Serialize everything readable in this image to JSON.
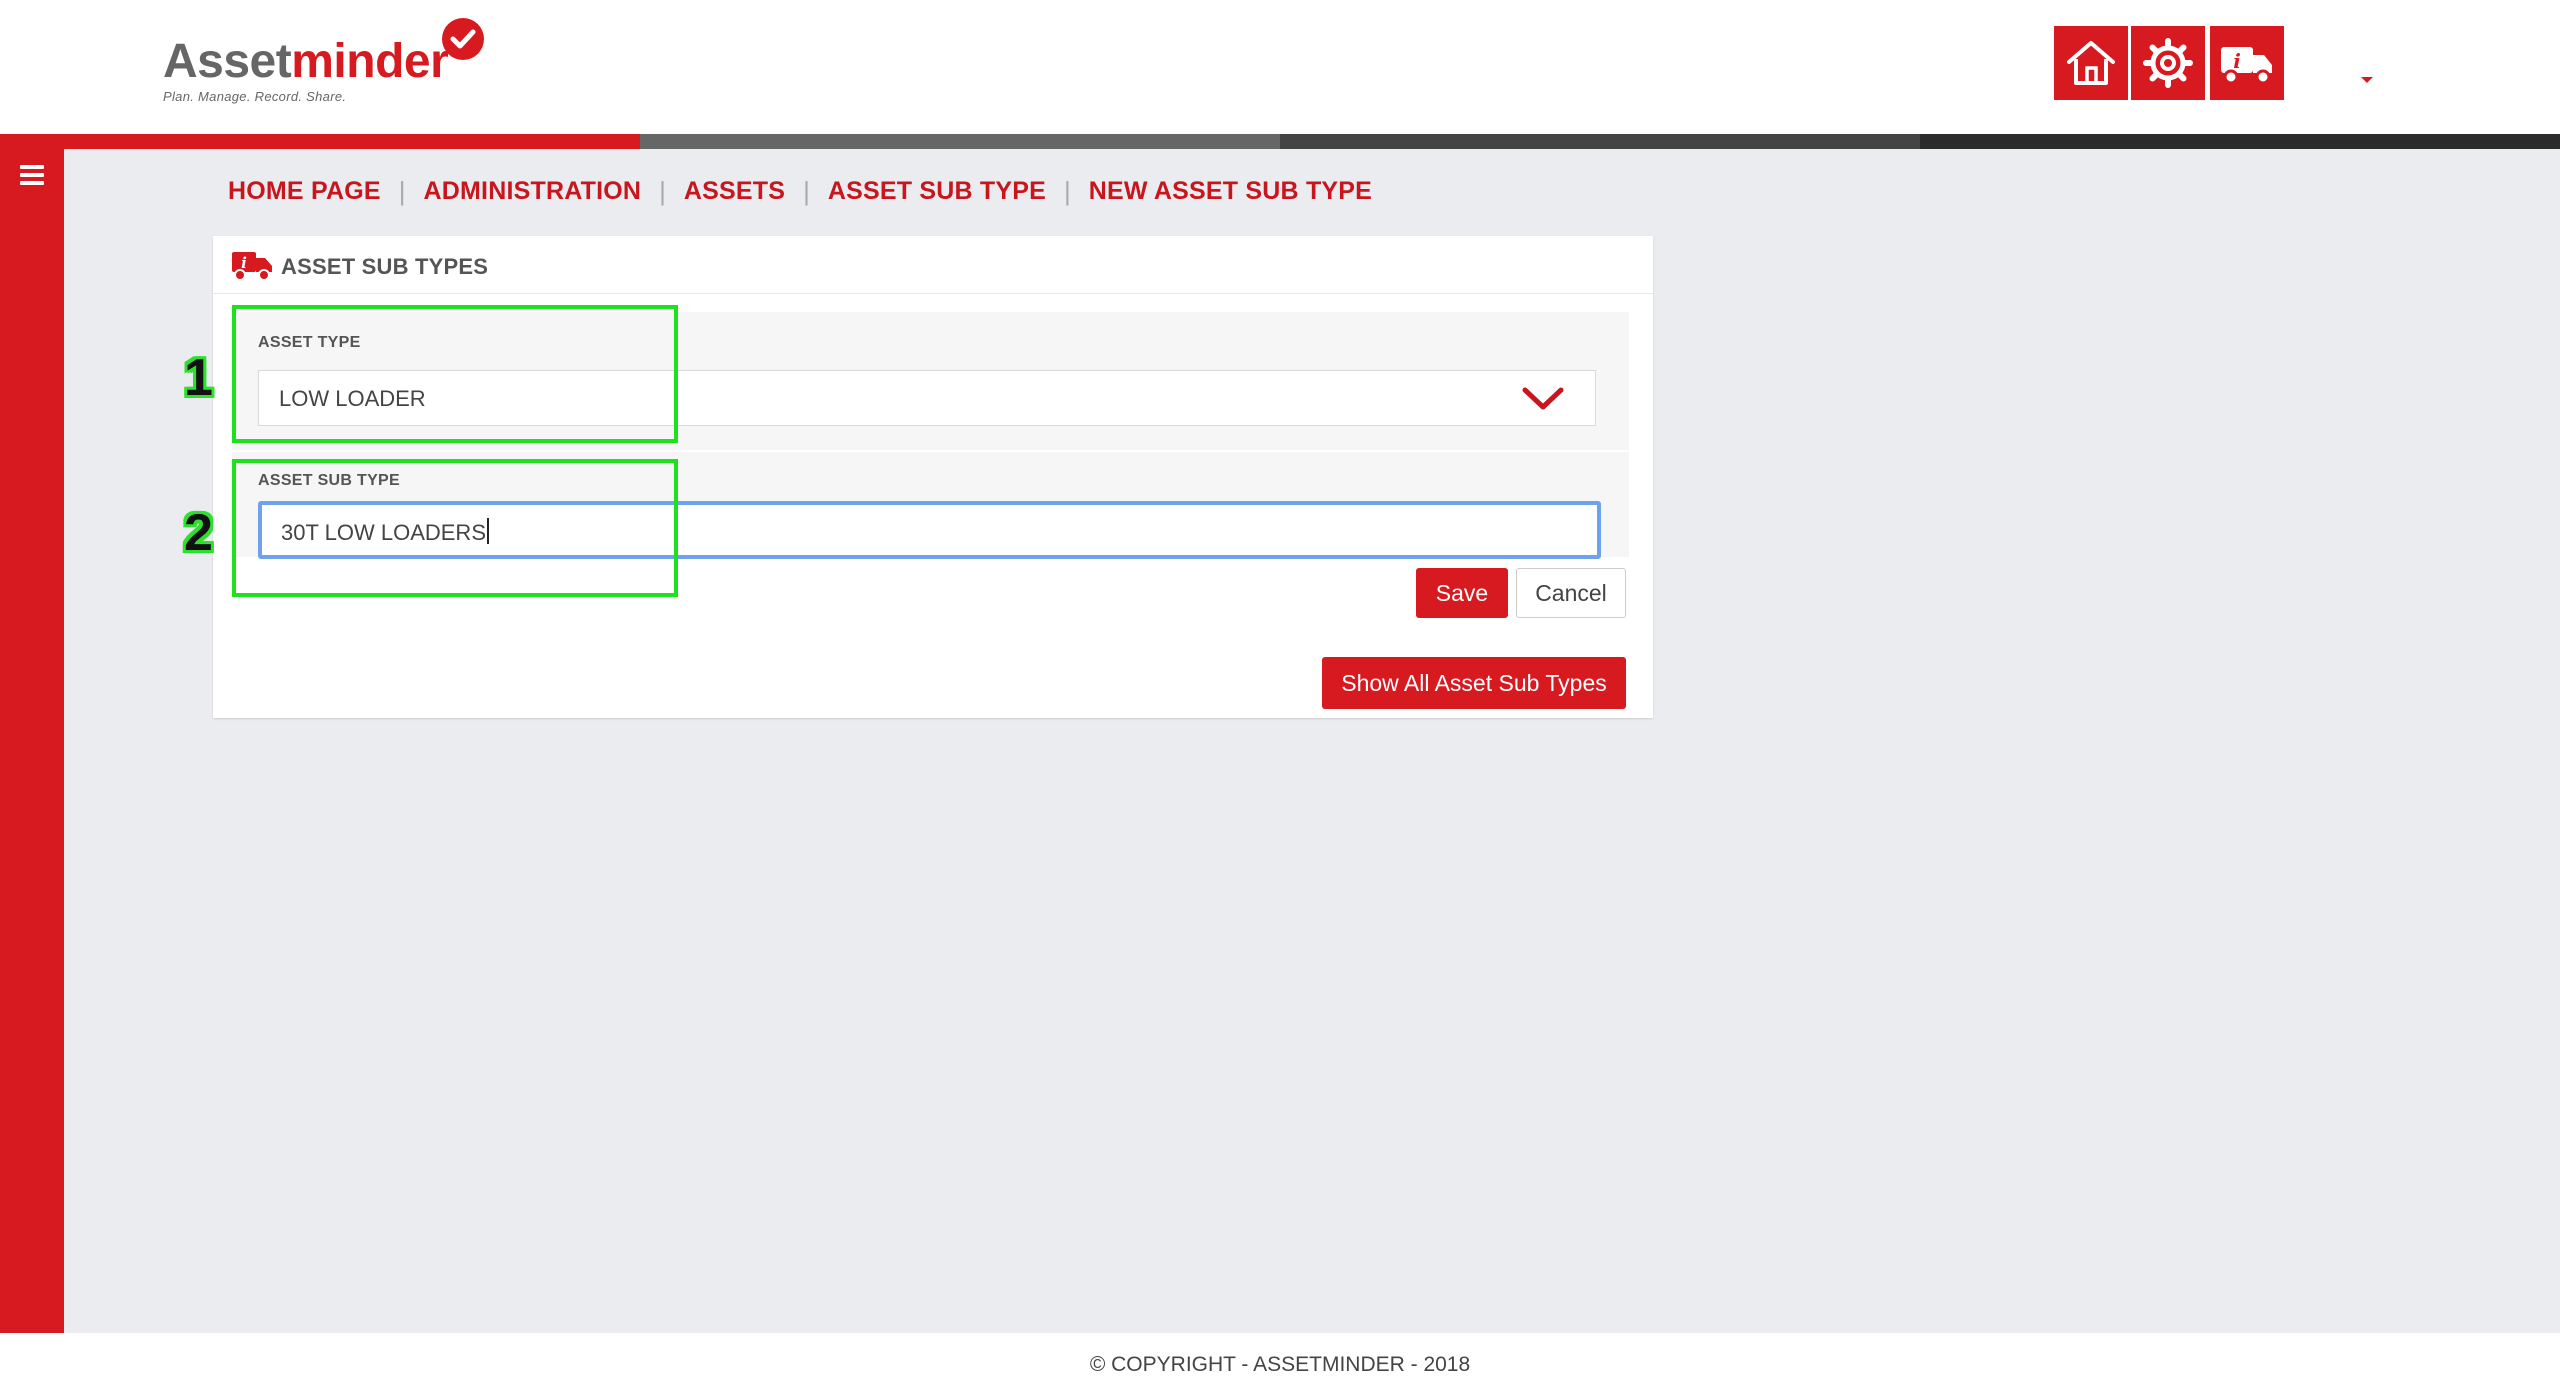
{
  "header": {
    "logo": {
      "text_part1": "Asset",
      "text_part2": "minder",
      "tagline": "Plan. Manage. Record. Share."
    },
    "icons": [
      "home-icon",
      "settings-cog-icon",
      "asset-truck-info-icon"
    ],
    "user_menu_caret": "caret-down-icon"
  },
  "strip_colors": [
    "#d71920",
    "#666666",
    "#444444",
    "#2b2b2b"
  ],
  "sidebar": {
    "menu_icon": "hamburger-menu-icon"
  },
  "breadcrumb": {
    "items": [
      "HOME PAGE",
      "ADMINISTRATION",
      "ASSETS",
      "ASSET SUB TYPE",
      "NEW ASSET SUB TYPE"
    ],
    "separator": "|"
  },
  "panel": {
    "title": "ASSET SUB TYPES",
    "asset_type": {
      "label": "ASSET TYPE",
      "value": "LOW LOADER"
    },
    "asset_sub_type": {
      "label": "ASSET SUB TYPE",
      "value": "30T LOW LOADERS"
    },
    "save_label": "Save",
    "cancel_label": "Cancel",
    "show_all_label": "Show All Asset Sub Types"
  },
  "annotations": [
    "1",
    "2"
  ],
  "footer": {
    "text": "© COPYRIGHT - ASSETMINDER - 2018"
  },
  "colors": {
    "brand_red": "#d71920",
    "focus_blue": "#6fa2ee",
    "annotation_green": "#1ee01e",
    "background": "#ebecf0"
  }
}
